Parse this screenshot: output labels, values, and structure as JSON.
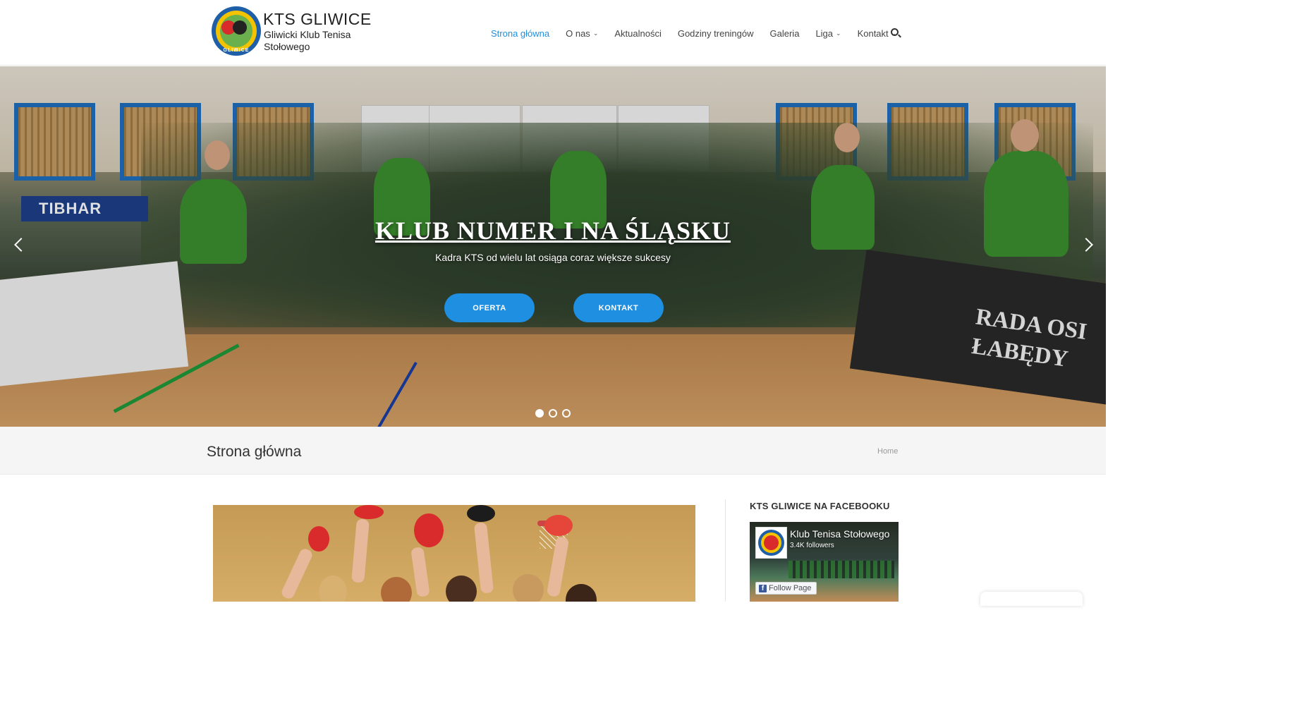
{
  "brand": {
    "title": "KTS GLIWICE",
    "subtitle": "Gliwicki Klub Tenisa Stołowego",
    "logo_text": "GLIWICE"
  },
  "nav": {
    "items": [
      {
        "label": "Strona główna",
        "active": true,
        "dropdown": false
      },
      {
        "label": "O nas",
        "active": false,
        "dropdown": true
      },
      {
        "label": "Aktualności",
        "active": false,
        "dropdown": false
      },
      {
        "label": "Godziny treningów",
        "active": false,
        "dropdown": false
      },
      {
        "label": "Galeria",
        "active": false,
        "dropdown": false
      },
      {
        "label": "Liga",
        "active": false,
        "dropdown": true
      },
      {
        "label": "Kontakt",
        "active": false,
        "dropdown": true
      }
    ],
    "search_icon": "search-icon"
  },
  "hero": {
    "title": "KLUB NUMER I NA ŚLĄSKU",
    "subtitle": "Kadra KTS od wielu lat osiąga coraz większe sukcesy",
    "buttons": [
      "OFERTA",
      "KONTAKT"
    ],
    "banner_left": "TIBHAR",
    "banner_right": [
      "RADA OSI",
      "ŁABĘDY"
    ],
    "slides": 3,
    "active_slide": 1
  },
  "page": {
    "title": "Strona główna",
    "breadcrumb": "Home"
  },
  "sidebar": {
    "widget_title": "KTS GLIWICE NA FACEBOOKU",
    "fb": {
      "name": "Klub Tenisa Stołowego",
      "followers": "3.4K followers",
      "follow_label": "Follow Page"
    }
  },
  "colors": {
    "accent": "#1e8fe1",
    "text": "#333333"
  }
}
